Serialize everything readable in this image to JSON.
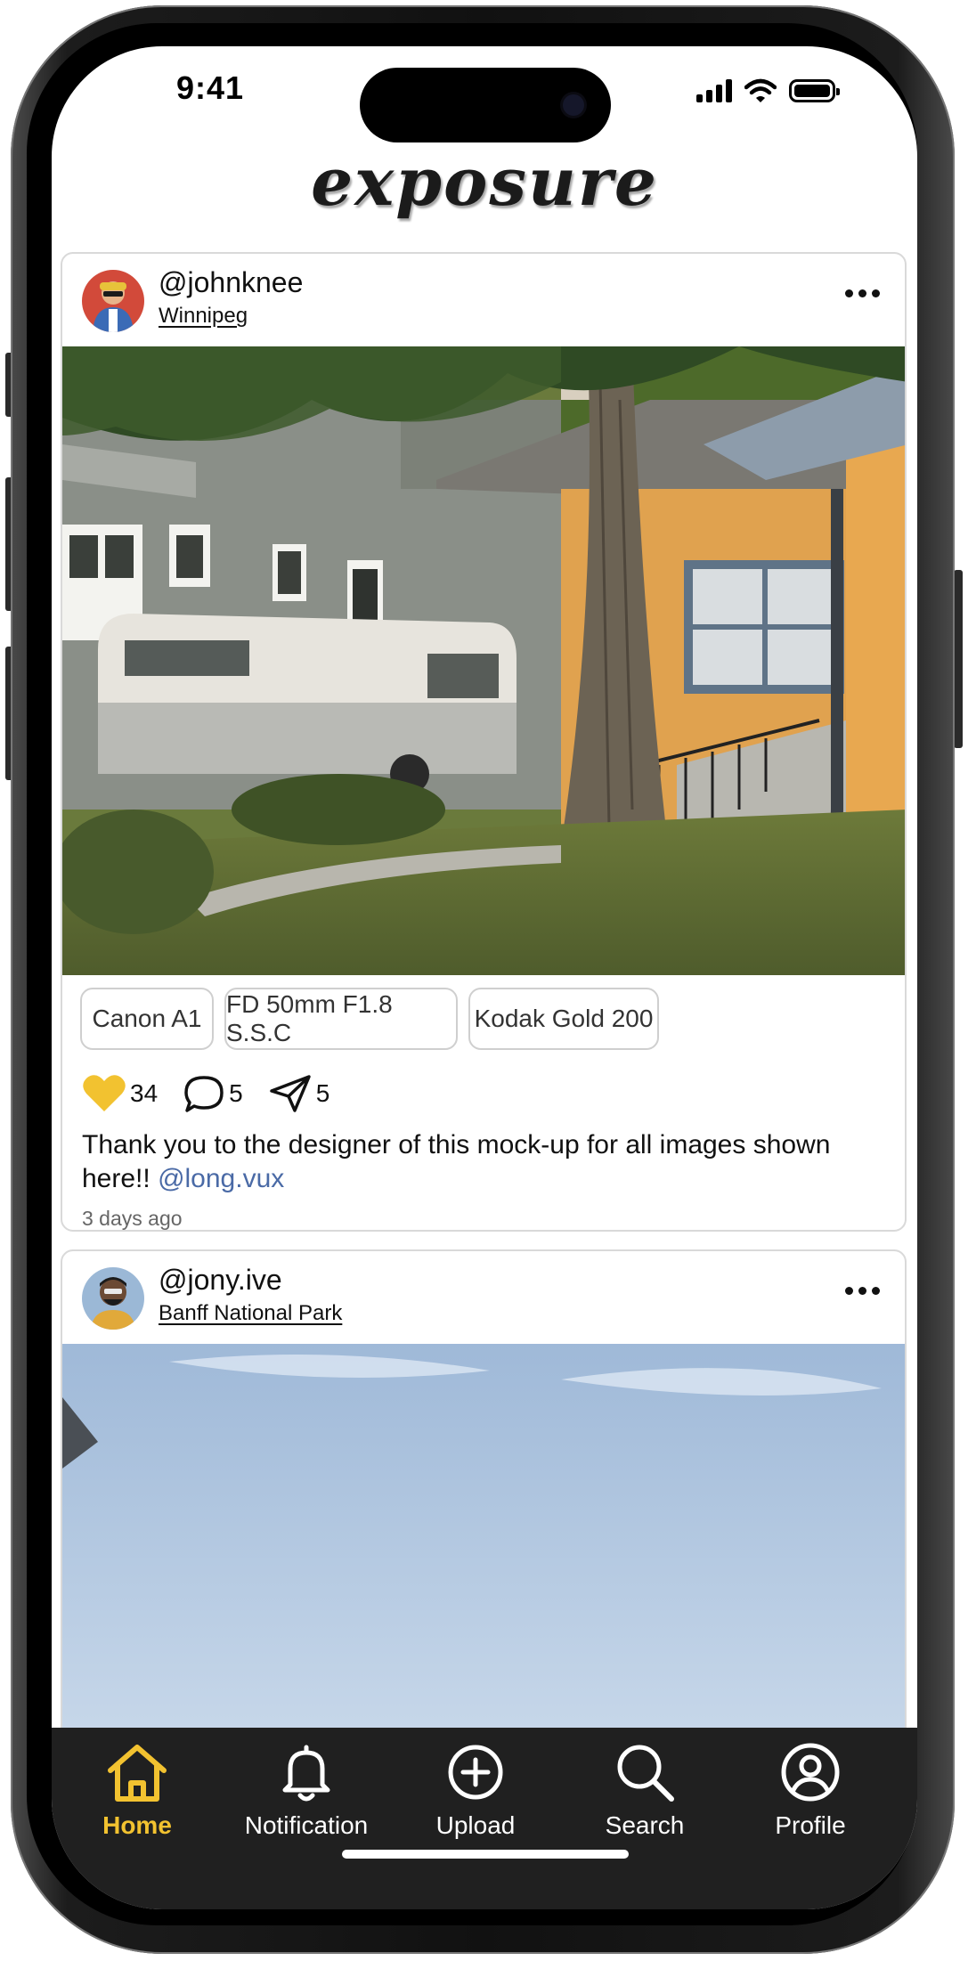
{
  "status_bar": {
    "time": "9:41"
  },
  "app": {
    "logo": "exposure"
  },
  "colors": {
    "accent": "#f2c230",
    "tabbar": "#202020",
    "mention": "#4a6aa6",
    "like": "#f2c230"
  },
  "posts": [
    {
      "username": "@johnknee",
      "location": "Winnipeg",
      "gear": [
        "Canon A1",
        "FD 50mm F1.8 S.S.C",
        "Kodak Gold 200"
      ],
      "likes": "34",
      "comments": "5",
      "shares": "5",
      "caption": "Thank you to the designer of this mock-up for all images shown here!!",
      "mention": "@long.vux",
      "time_ago": "3 days ago"
    },
    {
      "username": "@jony.ive",
      "location": "Banff National Park"
    }
  ],
  "tabbar": {
    "items": [
      {
        "label": "Home",
        "icon": "home-icon",
        "active": true
      },
      {
        "label": "Notification",
        "icon": "bell-icon"
      },
      {
        "label": "Upload",
        "icon": "plus-circle-icon"
      },
      {
        "label": "Search",
        "icon": "search-icon"
      },
      {
        "label": "Profile",
        "icon": "profile-icon"
      }
    ]
  }
}
